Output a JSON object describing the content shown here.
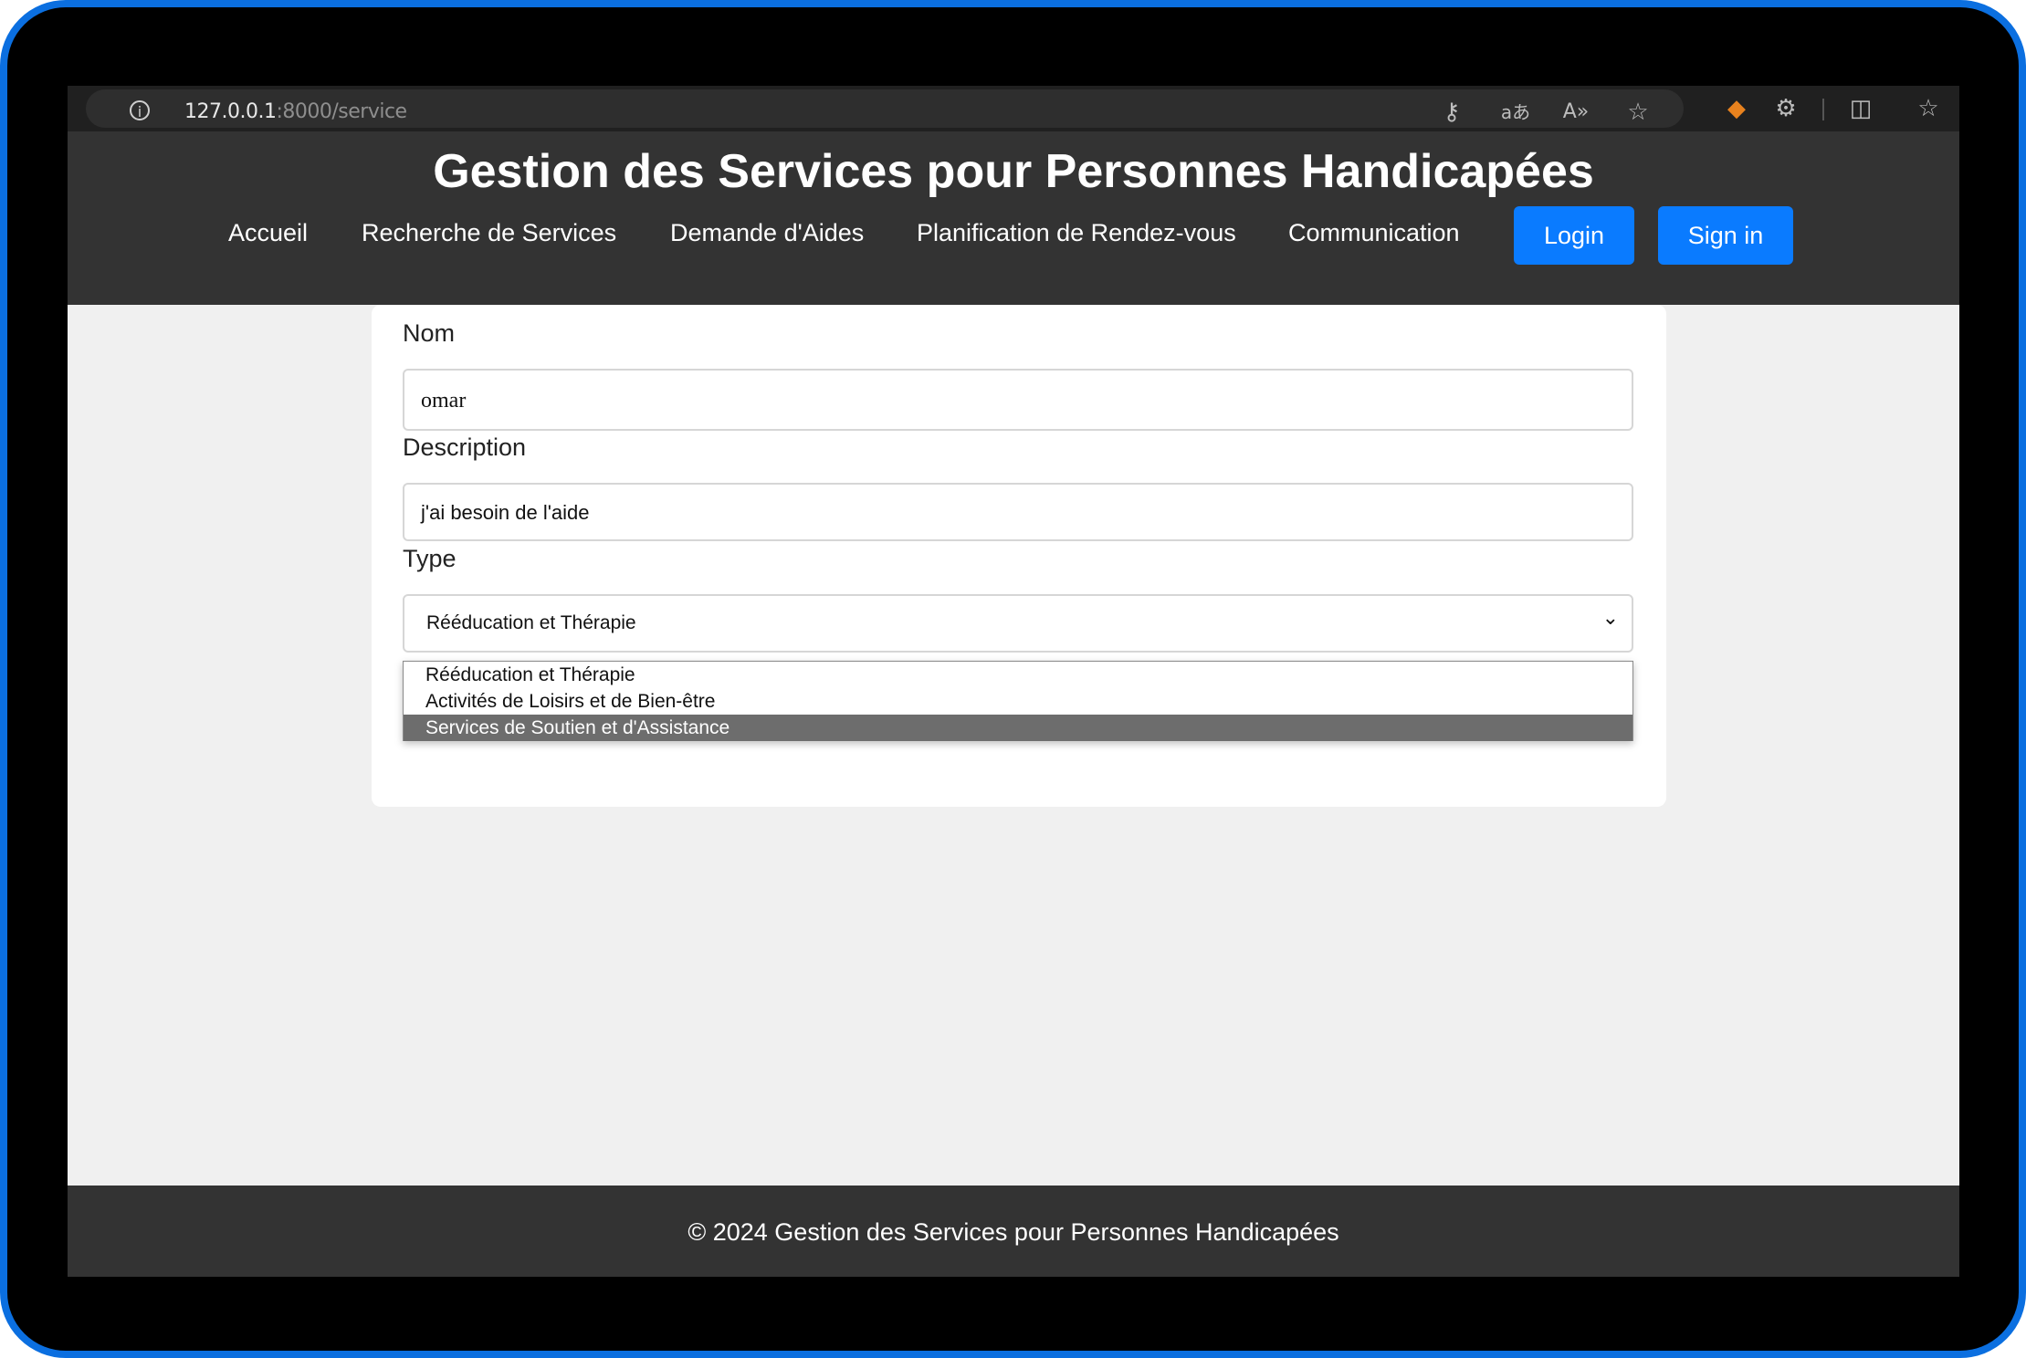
{
  "browser": {
    "url_host": "127.0.0.1",
    "url_rest": ":8000/service",
    "icons": [
      "info-icon",
      "key-icon",
      "translate-icon",
      "read-aloud-icon",
      "favorite-star-icon",
      "metamask-fox-icon",
      "extensions-icon",
      "split-screen-icon",
      "favorites-list-icon"
    ]
  },
  "header": {
    "title": "Gestion des Services pour Personnes Handicapées",
    "nav": [
      "Accueil",
      "Recherche de Services",
      "Demande d'Aides",
      "Planification de Rendez-vous",
      "Communication"
    ],
    "login_label": "Login",
    "signin_label": "Sign in"
  },
  "form": {
    "nom_label": "Nom",
    "nom_value": "omar",
    "description_label": "Description",
    "description_value": "j'ai besoin de l'aide",
    "type_label": "Type",
    "type_value": "Rééducation et Thérapie",
    "type_options": [
      "Rééducation et Thérapie",
      "Activités de Loisirs et de Bien-être",
      "Services de Soutien et d'Assistance"
    ],
    "highlighted_option_index": 2
  },
  "footer": {
    "text": "© 2024 Gestion des Services pour Personnes Handicapées"
  },
  "colors": {
    "frame": "#0b6fe0",
    "header_bg": "#333333",
    "button_blue": "#0a7bff",
    "page_bg": "#f0f0f0",
    "option_highlight": "#6d6d6d"
  }
}
